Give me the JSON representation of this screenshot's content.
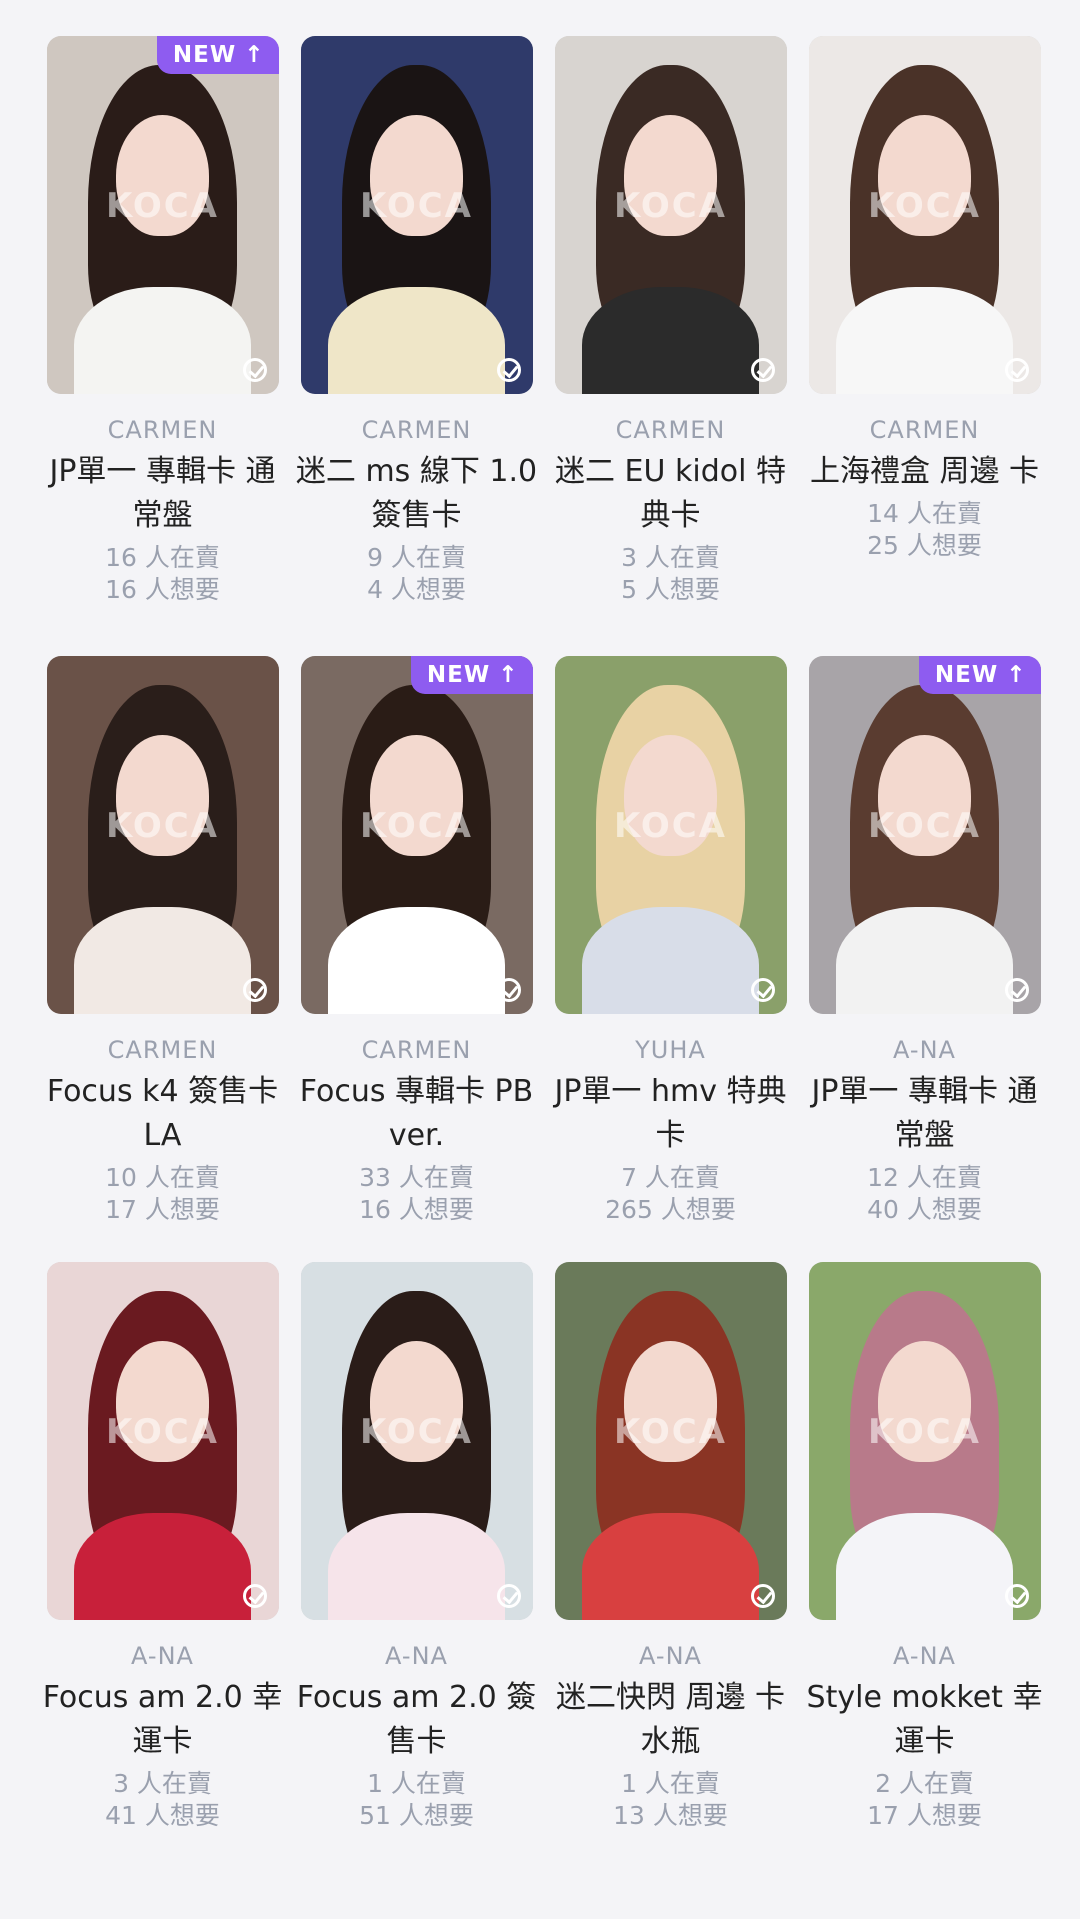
{
  "cards": [
    {
      "member": "CARMEN",
      "title": "JP單一 專輯卡 通常盤",
      "selling": "16 人在賣",
      "wanting": "16 人想要",
      "badge": "NEW",
      "watermark": "KOCA",
      "colors": {
        "bg": "#cfc7c0",
        "hair": "#2a1c18",
        "body": "#f4f4f2"
      }
    },
    {
      "member": "CARMEN",
      "title": "迷二 ms 線下 1.0 簽售卡",
      "selling": "9 人在賣",
      "wanting": "4 人想要",
      "badge": "",
      "watermark": "KOCA",
      "colors": {
        "bg": "#2f3a6a",
        "hair": "#1a1414",
        "body": "#efe6c8"
      }
    },
    {
      "member": "CARMEN",
      "title": "迷二 EU kidol 特典卡",
      "selling": "3 人在賣",
      "wanting": "5 人想要",
      "badge": "",
      "watermark": "KOCA",
      "colors": {
        "bg": "#d8d4d0",
        "hair": "#3a2a24",
        "body": "#2b2b2b"
      }
    },
    {
      "member": "CARMEN",
      "title": "上海禮盒 周邊 卡",
      "selling": "14 人在賣",
      "wanting": "25 人想要",
      "badge": "",
      "watermark": "KOCA",
      "colors": {
        "bg": "#ece8e6",
        "hair": "#4a3228",
        "body": "#f7f7f7"
      }
    },
    {
      "member": "CARMEN",
      "title": "Focus k4 簽售卡 LA",
      "selling": "10 人在賣",
      "wanting": "17 人想要",
      "badge": "",
      "watermark": "KOCA",
      "colors": {
        "bg": "#6a5248",
        "hair": "#2a1e1a",
        "body": "#f1e9e4"
      }
    },
    {
      "member": "CARMEN",
      "title": "Focus 專輯卡 PB ver.",
      "selling": "33 人在賣",
      "wanting": "16 人想要",
      "badge": "NEW",
      "watermark": "KOCA",
      "colors": {
        "bg": "#7a6a62",
        "hair": "#2a1c16",
        "body": "#ffffff"
      }
    },
    {
      "member": "YUHA",
      "title": "JP單一 hmv 特典卡",
      "selling": "7 人在賣",
      "wanting": "265 人想要",
      "badge": "",
      "watermark": "KOCA",
      "colors": {
        "bg": "#8aa06a",
        "hair": "#e8d2a4",
        "body": "#d8dde8"
      }
    },
    {
      "member": "A-NA",
      "title": "JP單一 專輯卡 通常盤",
      "selling": "12 人在賣",
      "wanting": "40 人想要",
      "badge": "NEW",
      "watermark": "KOCA",
      "colors": {
        "bg": "#a8a4a8",
        "hair": "#5a3c30",
        "body": "#f2f2f2"
      }
    },
    {
      "member": "A-NA",
      "title": "Focus am 2.0 幸運卡",
      "selling": "3 人在賣",
      "wanting": "41 人想要",
      "badge": "",
      "watermark": "KOCA",
      "colors": {
        "bg": "#e9d6d6",
        "hair": "#6a1a20",
        "body": "#c8203a"
      }
    },
    {
      "member": "A-NA",
      "title": "Focus am 2.0 簽售卡",
      "selling": "1 人在賣",
      "wanting": "51 人想要",
      "badge": "",
      "watermark": "KOCA",
      "colors": {
        "bg": "#d7dfe3",
        "hair": "#2a1c18",
        "body": "#f6e4ea"
      }
    },
    {
      "member": "A-NA",
      "title": "迷二快閃 周邊 卡 水瓶",
      "selling": "1 人在賣",
      "wanting": "13 人想要",
      "badge": "",
      "watermark": "KOCA",
      "colors": {
        "bg": "#6a7a5a",
        "hair": "#8a3424",
        "body": "#d84040"
      }
    },
    {
      "member": "A-NA",
      "title": "Style mokket 幸運卡",
      "selling": "2 人在賣",
      "wanting": "17 人想要",
      "badge": "",
      "watermark": "KOCA",
      "colors": {
        "bg": "#8aa86a",
        "hair": "#b87a8a",
        "body": "#f4f4f8"
      }
    }
  ]
}
